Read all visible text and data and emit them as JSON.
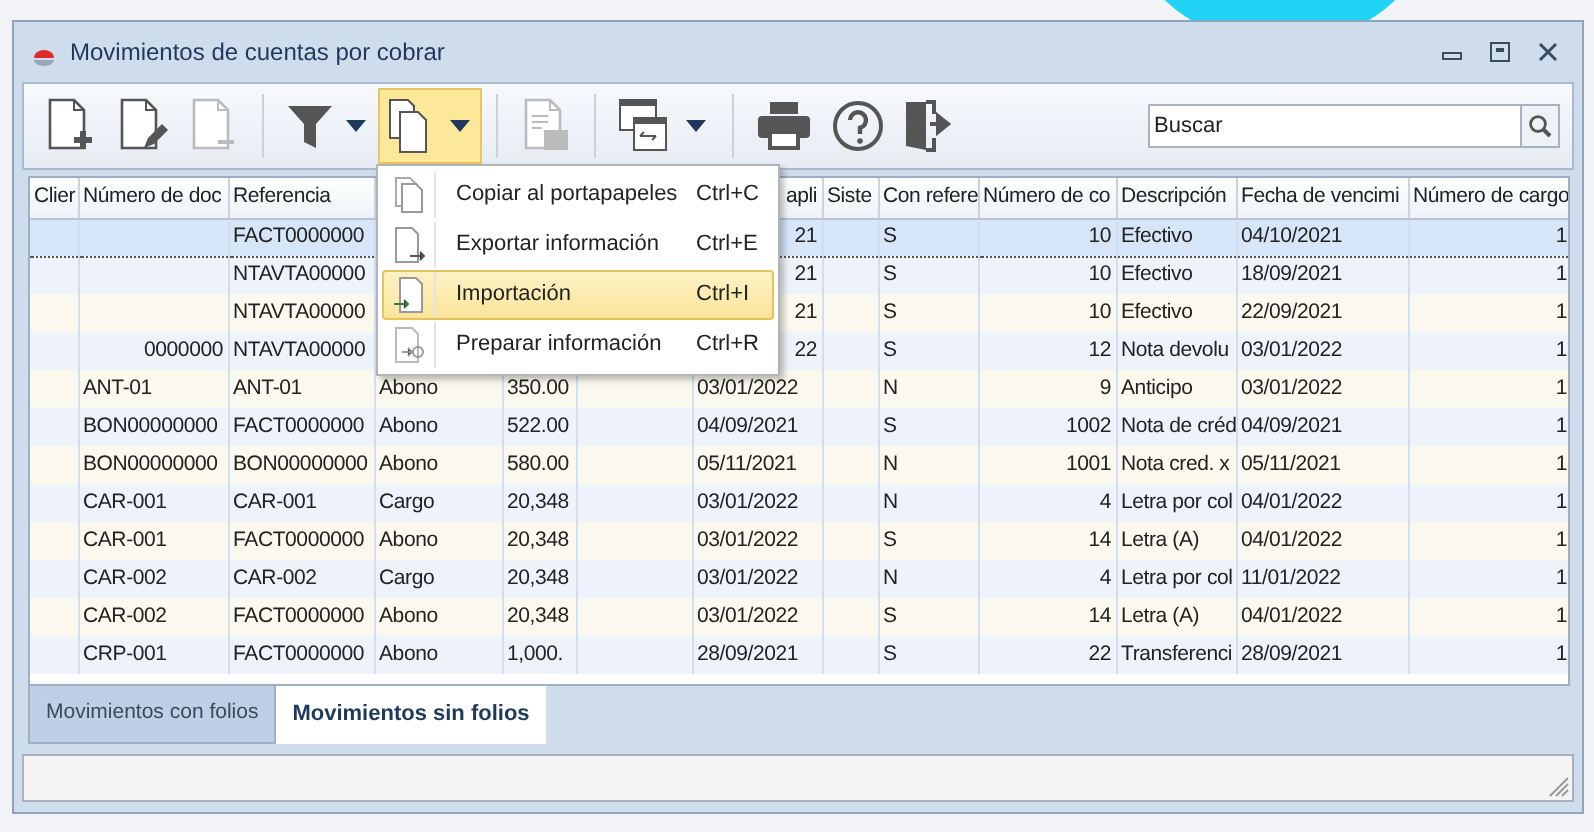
{
  "window": {
    "title": "Movimientos de cuentas por cobrar"
  },
  "toolbar": {
    "buttons": [
      {
        "kind": "new",
        "disabled": false,
        "pressed": false
      },
      {
        "kind": "edit",
        "disabled": false,
        "pressed": false
      },
      {
        "kind": "delete",
        "disabled": true,
        "pressed": false
      },
      {
        "kind": "filter",
        "disabled": false,
        "pressed": false
      },
      {
        "kind": "copy",
        "disabled": false,
        "pressed": true
      },
      {
        "kind": "calendar",
        "disabled": true,
        "pressed": false
      },
      {
        "kind": "windows",
        "disabled": false,
        "pressed": false
      },
      {
        "kind": "print",
        "disabled": false,
        "pressed": false
      },
      {
        "kind": "help",
        "disabled": false,
        "pressed": false
      },
      {
        "kind": "exit",
        "disabled": false,
        "pressed": false
      }
    ],
    "search": {
      "placeholder": "Buscar"
    }
  },
  "menu": {
    "items": [
      {
        "label": "Copiar al portapapeles",
        "shortcut": "Ctrl+C",
        "selected": false,
        "kind": "copy"
      },
      {
        "label": "Exportar información",
        "shortcut": "Ctrl+E",
        "selected": false,
        "kind": "export"
      },
      {
        "label": "Importación",
        "shortcut": "Ctrl+I",
        "selected": true,
        "kind": "import"
      },
      {
        "label": "Preparar información",
        "shortcut": "Ctrl+R",
        "selected": false,
        "kind": "prepare"
      }
    ]
  },
  "table": {
    "columns": [
      "Clier",
      "Número de doc",
      "Referencia",
      null,
      null,
      null,
      "apli",
      "Siste",
      "Con refere",
      "Número de co",
      "Descripción",
      "Fecha de vencimi",
      "Número de cargo"
    ],
    "rows": [
      {
        "selected": true,
        "cells": [
          null,
          null,
          "FACT0000000",
          null,
          null,
          null,
          "21",
          null,
          "S",
          "10",
          "Efectivo",
          "04/10/2021",
          "1"
        ]
      },
      {
        "selected": false,
        "cells": [
          null,
          null,
          "NTAVTA00000",
          null,
          null,
          null,
          "21",
          null,
          "S",
          "10",
          "Efectivo",
          "18/09/2021",
          "1"
        ]
      },
      {
        "selected": false,
        "cells": [
          null,
          null,
          "NTAVTA00000",
          null,
          null,
          null,
          "21",
          null,
          "S",
          "10",
          "Efectivo",
          "22/09/2021",
          "1"
        ]
      },
      {
        "selected": false,
        "cells": [
          null,
          "0000000",
          "NTAVTA00000",
          null,
          null,
          null,
          "22",
          null,
          "S",
          "12",
          "Nota devolu",
          "03/01/2022",
          "1"
        ]
      },
      {
        "selected": false,
        "cells": [
          null,
          "ANT-01",
          "ANT-01",
          "Abono",
          "350.00",
          null,
          "03/01/2022",
          null,
          "N",
          "9",
          "Anticipo",
          "03/01/2022",
          "1"
        ]
      },
      {
        "selected": false,
        "cells": [
          null,
          "BON00000000",
          "FACT0000000",
          "Abono",
          "522.00",
          null,
          "04/09/2021",
          null,
          "S",
          "1002",
          "Nota de créd",
          "04/09/2021",
          "1"
        ]
      },
      {
        "selected": false,
        "cells": [
          null,
          "BON00000000",
          "BON00000000",
          "Abono",
          "580.00",
          null,
          "05/11/2021",
          null,
          "N",
          "1001",
          "Nota cred. x",
          "05/11/2021",
          "1"
        ]
      },
      {
        "selected": false,
        "cells": [
          null,
          "CAR-001",
          "CAR-001",
          "Cargo",
          "20,348",
          null,
          "03/01/2022",
          null,
          "N",
          "4",
          "Letra por col",
          "04/01/2022",
          "1"
        ]
      },
      {
        "selected": false,
        "cells": [
          null,
          "CAR-001",
          "FACT0000000",
          "Abono",
          "20,348",
          null,
          "03/01/2022",
          null,
          "S",
          "14",
          "Letra (A)",
          "04/01/2022",
          "1"
        ]
      },
      {
        "selected": false,
        "cells": [
          null,
          "CAR-002",
          "CAR-002",
          "Cargo",
          "20,348",
          null,
          "03/01/2022",
          null,
          "N",
          "4",
          "Letra por col",
          "11/01/2022",
          "1"
        ]
      },
      {
        "selected": false,
        "cells": [
          null,
          "CAR-002",
          "FACT0000000",
          "Abono",
          "20,348",
          null,
          "03/01/2022",
          null,
          "S",
          "14",
          "Letra (A)",
          "04/01/2022",
          "1"
        ]
      },
      {
        "selected": false,
        "cells": [
          null,
          "CRP-001",
          "FACT0000000",
          "Abono",
          "1,000.",
          null,
          "28/09/2021",
          null,
          "S",
          "22",
          "Transferenci",
          "28/09/2021",
          "1"
        ]
      }
    ]
  },
  "tabs": [
    {
      "label": "Movimientos con folios",
      "selected": false
    },
    {
      "label": "Movimientos sin folios",
      "selected": true
    }
  ]
}
